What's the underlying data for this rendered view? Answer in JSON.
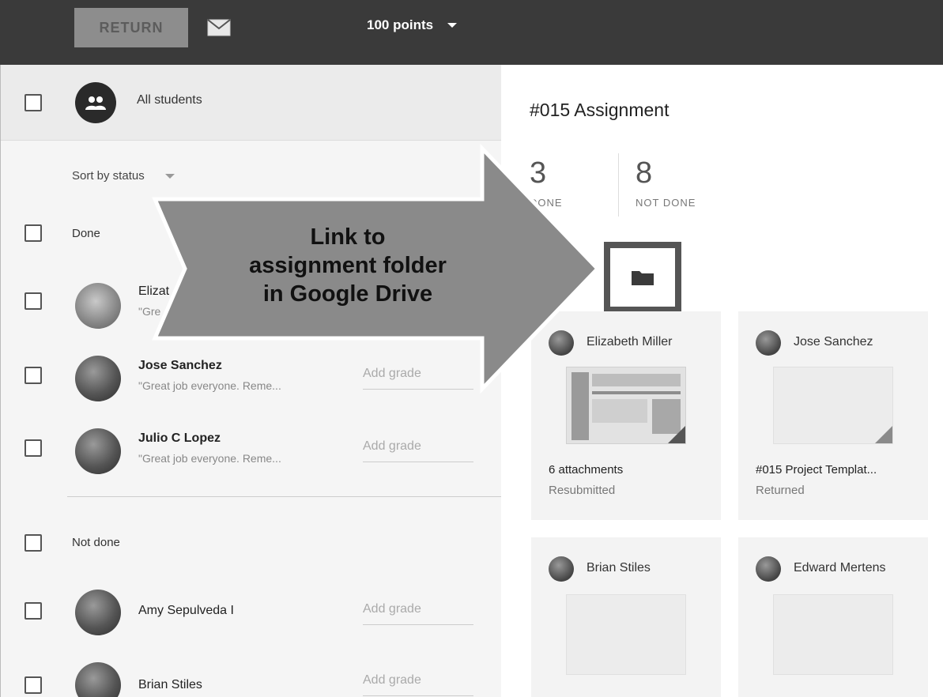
{
  "toolbar": {
    "return_label": "RETURN",
    "points_label": "100 points"
  },
  "roster": {
    "all_students_label": "All students",
    "sort_label": "Sort by status",
    "done_label": "Done",
    "not_done_label": "Not done",
    "done_students": [
      {
        "name": "Elizat",
        "comment": "\"Gre",
        "grade_placeholder": ""
      },
      {
        "name": "Jose Sanchez",
        "comment": "\"Great job everyone. Reme...",
        "grade_placeholder": "Add grade"
      },
      {
        "name": "Julio C Lopez",
        "comment": "\"Great job everyone. Reme...",
        "grade_placeholder": "Add grade"
      }
    ],
    "not_done_students": [
      {
        "name": "Amy Sepulveda I",
        "grade_placeholder": "Add grade"
      },
      {
        "name": "Brian Stiles",
        "grade_placeholder": "Add grade"
      }
    ]
  },
  "assignment": {
    "title": "#015 Assignment",
    "done_count": "3",
    "done_label": "DONE",
    "not_done_count": "8",
    "not_done_label": "NOT DONE"
  },
  "submissions": [
    {
      "name": "Elizabeth Miller",
      "detail": "6 attachments",
      "status": "Resubmitted"
    },
    {
      "name": "Jose Sanchez",
      "detail": "#015 Project Templat...",
      "status": "Returned"
    },
    {
      "name": "Brian Stiles",
      "detail": "",
      "status": ""
    },
    {
      "name": "Edward Mertens",
      "detail": "",
      "status": ""
    }
  ],
  "callout": {
    "line1": "Link to",
    "line2": "assignment folder",
    "line3": "in Google Drive"
  },
  "icons": {
    "mail": "mail-icon",
    "group": "group-icon",
    "folder": "folder-icon",
    "dropdown": "caret-down-icon"
  },
  "colors": {
    "topbar": "#3a3a3a",
    "arrow_fill": "#8a8a8a",
    "folder_highlight": "#555555"
  }
}
